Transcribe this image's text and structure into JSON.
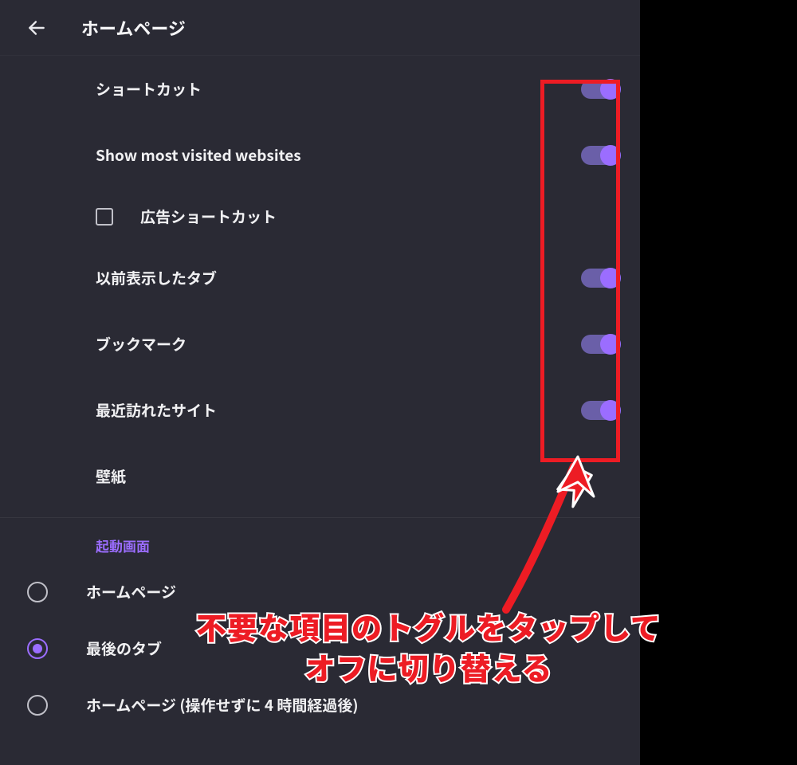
{
  "header": {
    "title": "ホームページ"
  },
  "settings": {
    "shortcuts": {
      "label": "ショートカット",
      "enabled": true
    },
    "most_visited": {
      "label": "Show most visited websites",
      "enabled": true
    },
    "ad_shortcut": {
      "label": "広告ショートカット",
      "checked": false
    },
    "previous_tabs": {
      "label": "以前表示したタブ",
      "enabled": true
    },
    "bookmarks": {
      "label": "ブックマーク",
      "enabled": true
    },
    "recent_sites": {
      "label": "最近訪れたサイト",
      "enabled": true
    },
    "wallpaper": {
      "label": "壁紙"
    }
  },
  "startup": {
    "section_title": "起動画面",
    "options": [
      {
        "label": "ホームページ",
        "selected": false
      },
      {
        "label": "最後のタブ",
        "selected": true
      },
      {
        "label": "ホームページ (操作せずに 4 時間経過後)",
        "selected": false
      }
    ]
  },
  "annotation": {
    "line1": "不要な項目のトグルをタップして",
    "line2": "オフに切り替える"
  }
}
